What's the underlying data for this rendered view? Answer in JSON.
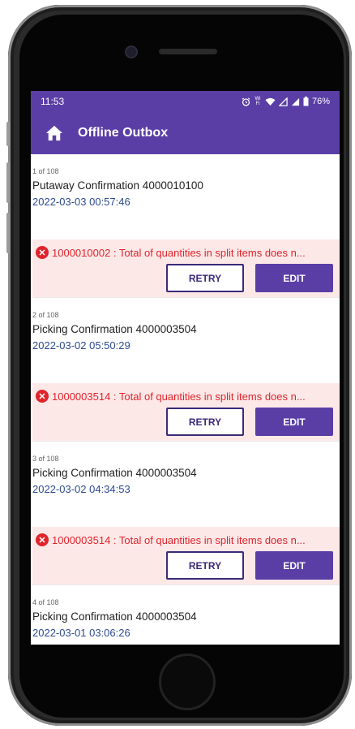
{
  "status_bar": {
    "time": "11:53",
    "icons": [
      "alarm-icon",
      "vowifi-icon",
      "wifi-icon",
      "signal-icon",
      "signal-icon",
      "battery-icon"
    ],
    "wifi_label": "Wi Fi",
    "battery": "76%"
  },
  "app_bar": {
    "title": "Offline Outbox",
    "home_icon": "home-icon"
  },
  "colors": {
    "primary": "#5a3ea6",
    "error": "#e0242b",
    "error_bg": "#fde8e8",
    "date": "#2d4a92"
  },
  "buttons": {
    "retry": "RETRY",
    "edit": "EDIT"
  },
  "items": [
    {
      "counter": "1 of 108",
      "title": "Putaway Confirmation 4000010100",
      "date": "2022-03-03 00:57:46",
      "error": "1000010002 : Total of quantities in split items does n..."
    },
    {
      "counter": "2 of 108",
      "title": "Picking Confirmation 4000003504",
      "date": "2022-03-02 05:50:29",
      "error": "1000003514 : Total of quantities in split items does n..."
    },
    {
      "counter": "3 of 108",
      "title": "Picking Confirmation 4000003504",
      "date": "2022-03-02 04:34:53",
      "error": "1000003514 : Total of quantities in split items does n..."
    },
    {
      "counter": "4 of 108",
      "title": "Picking Confirmation 4000003504",
      "date": "2022-03-01 03:06:26"
    }
  ]
}
